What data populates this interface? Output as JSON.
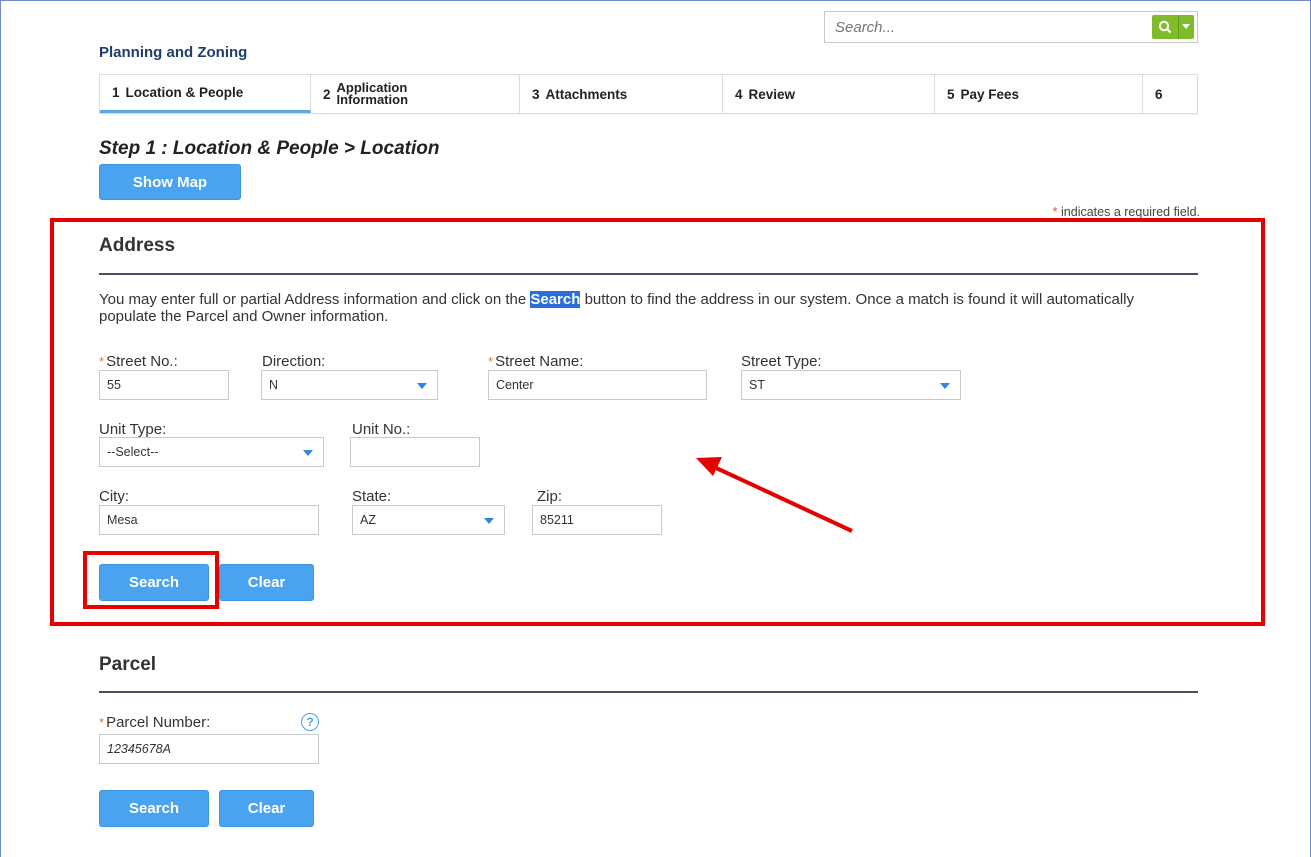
{
  "header": {
    "search_placeholder": "Search...",
    "module_title": "Planning and Zoning"
  },
  "tabs": [
    {
      "num": "1",
      "label": "Location & People"
    },
    {
      "num": "2",
      "label": "Application Information"
    },
    {
      "num": "3",
      "label": "Attachments"
    },
    {
      "num": "4",
      "label": "Review"
    },
    {
      "num": "5",
      "label": "Pay Fees"
    },
    {
      "num": "6",
      "label": ""
    }
  ],
  "step_title": "Step 1 : Location & People > Location",
  "show_map_label": "Show Map",
  "required_note": {
    "star": "*",
    "text": " indicates a required field."
  },
  "address": {
    "title": "Address",
    "description_before": "You may enter full or partial Address information and click on the ",
    "description_highlight": "Search",
    "description_after": " button to find the address in our system. Once a match is found it will automatically populate the Parcel and Owner information.",
    "street_no_label": "Street No.:",
    "street_no_value": "55",
    "direction_label": "Direction:",
    "direction_value": "N",
    "street_name_label": "Street Name:",
    "street_name_value": "Center",
    "street_type_label": "Street Type:",
    "street_type_value": "ST",
    "unit_type_label": "Unit Type:",
    "unit_type_value": "--Select--",
    "unit_no_label": "Unit No.:",
    "unit_no_value": "",
    "city_label": "City:",
    "city_value": "Mesa",
    "state_label": "State:",
    "state_value": "AZ",
    "zip_label": "Zip:",
    "zip_value": "85211",
    "search_label": "Search",
    "clear_label": "Clear"
  },
  "parcel": {
    "title": "Parcel",
    "parcel_number_label": "Parcel Number:",
    "parcel_number_value": "12345678A",
    "help_icon": "?",
    "search_label": "Search",
    "clear_label": "Clear"
  },
  "annotation_colors": {
    "highlight_box": "#e60000",
    "arrow": "#e60000"
  },
  "icons": {
    "search": "search-icon",
    "dropdown": "chevron-down-icon",
    "help": "help-icon"
  }
}
